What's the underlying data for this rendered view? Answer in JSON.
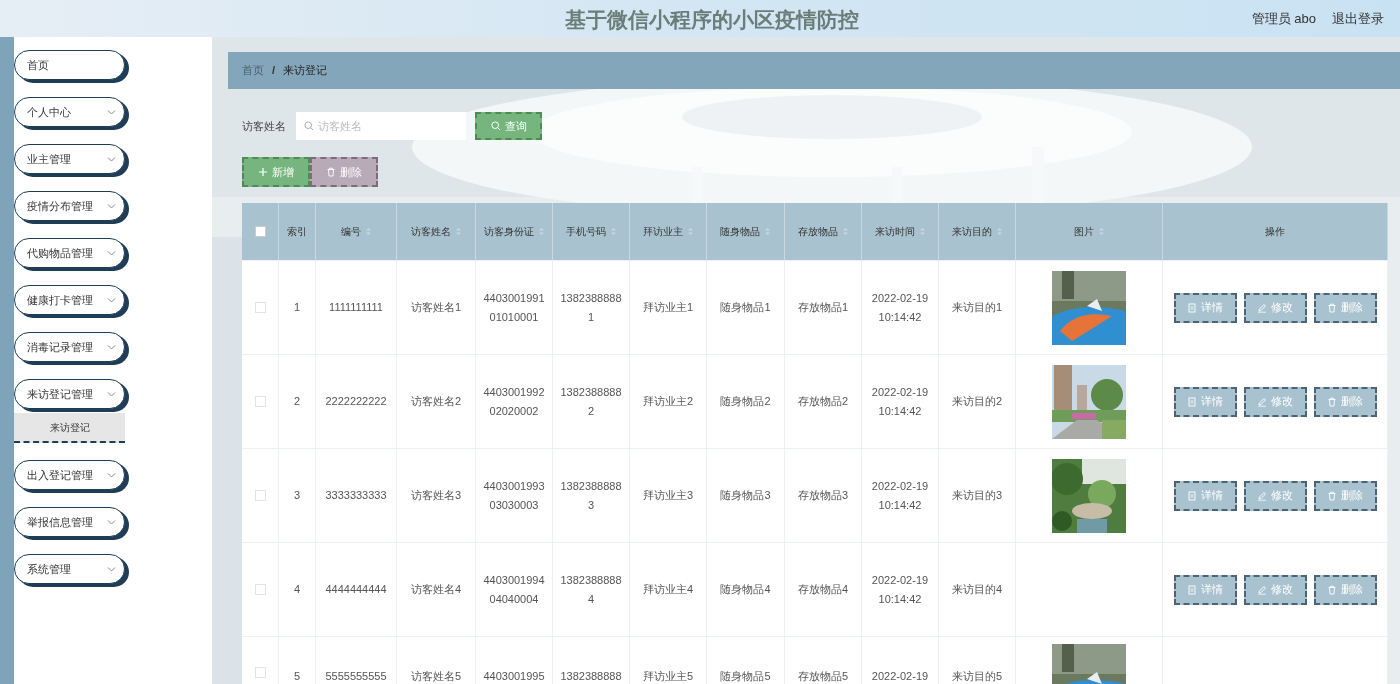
{
  "header": {
    "title": "基于微信小程序的小区疫情防控",
    "user": "管理员 abo",
    "logout": "退出登录"
  },
  "sidebar": {
    "items": [
      {
        "label": "首页",
        "has_arrow": false
      },
      {
        "label": "个人中心",
        "has_arrow": true
      },
      {
        "label": "业主管理",
        "has_arrow": true
      },
      {
        "label": "疫情分布管理",
        "has_arrow": true
      },
      {
        "label": "代购物品管理",
        "has_arrow": true
      },
      {
        "label": "健康打卡管理",
        "has_arrow": true
      },
      {
        "label": "消毒记录管理",
        "has_arrow": true
      },
      {
        "label": "来访登记管理",
        "has_arrow": true,
        "children": [
          {
            "label": "来访登记",
            "selected": true
          }
        ]
      },
      {
        "label": "出入登记管理",
        "has_arrow": true
      },
      {
        "label": "举报信息管理",
        "has_arrow": true
      },
      {
        "label": "系统管理",
        "has_arrow": true
      }
    ]
  },
  "breadcrumb": {
    "items": [
      "首页",
      "来访登记"
    ],
    "separator": "/"
  },
  "search": {
    "label": "访客姓名",
    "placeholder": "访客姓名",
    "button": "查询"
  },
  "actions": [
    {
      "kind": "add",
      "label": "新增"
    },
    {
      "kind": "delete",
      "label": "删除"
    }
  ],
  "table": {
    "select_all": {
      "checked": false
    },
    "columns": [
      {
        "label": "索引",
        "sortable": false
      },
      {
        "label": "编号",
        "sortable": true
      },
      {
        "label": "访客姓名",
        "sortable": true
      },
      {
        "label": "访客身份证",
        "sortable": true
      },
      {
        "label": "手机号码",
        "sortable": true
      },
      {
        "label": "拜访业主",
        "sortable": true
      },
      {
        "label": "随身物品",
        "sortable": true
      },
      {
        "label": "存放物品",
        "sortable": true
      },
      {
        "label": "来访时间",
        "sortable": true
      },
      {
        "label": "来访目的",
        "sortable": true
      },
      {
        "label": "图片",
        "sortable": true
      },
      {
        "label": "操作",
        "sortable": false
      }
    ],
    "rows": [
      {
        "checked": false,
        "cells": [
          "1",
          "1111111111",
          "访客姓名1",
          "440300199101010001",
          "13823888881",
          "拜访业主1",
          "随身物品1",
          "存放物品1",
          "2022-02-19 10:14:42",
          "来访目的1"
        ],
        "picture": true,
        "buttons": [
          {
            "kind": "detail",
            "label": "详情"
          },
          {
            "kind": "edit",
            "label": "修改"
          },
          {
            "kind": "delete",
            "label": "删除"
          }
        ]
      },
      {
        "checked": false,
        "cells": [
          "2",
          "2222222222",
          "访客姓名2",
          "440300199202020002",
          "13823888882",
          "拜访业主2",
          "随身物品2",
          "存放物品2",
          "2022-02-19 10:14:42",
          "来访目的2"
        ],
        "picture": true,
        "buttons": [
          {
            "kind": "detail",
            "label": "详情"
          },
          {
            "kind": "edit",
            "label": "修改"
          },
          {
            "kind": "delete",
            "label": "删除"
          }
        ]
      },
      {
        "checked": false,
        "cells": [
          "3",
          "3333333333",
          "访客姓名3",
          "440300199303030003",
          "13823888883",
          "拜访业主3",
          "随身物品3",
          "存放物品3",
          "2022-02-19 10:14:42",
          "来访目的3"
        ],
        "picture": true,
        "buttons": [
          {
            "kind": "detail",
            "label": "详情"
          },
          {
            "kind": "edit",
            "label": "修改"
          },
          {
            "kind": "delete",
            "label": "删除"
          }
        ]
      },
      {
        "checked": false,
        "cells": [
          "4",
          "4444444444",
          "访客姓名4",
          "440300199404040004",
          "13823888884",
          "拜访业主4",
          "随身物品4",
          "存放物品4",
          "2022-02-19 10:14:42",
          "来访目的4"
        ],
        "picture": false,
        "buttons": [
          {
            "kind": "detail",
            "label": "详情"
          },
          {
            "kind": "edit",
            "label": "修改"
          },
          {
            "kind": "delete",
            "label": "删除"
          }
        ]
      },
      {
        "checked": false,
        "cells": [
          "5",
          "5555555555",
          "访客姓名5",
          "4403001995",
          "1382388888",
          "拜访业主5",
          "随身物品5",
          "存放物品5",
          "2022-02-19",
          "来访目的5"
        ],
        "picture": true
      }
    ]
  }
}
